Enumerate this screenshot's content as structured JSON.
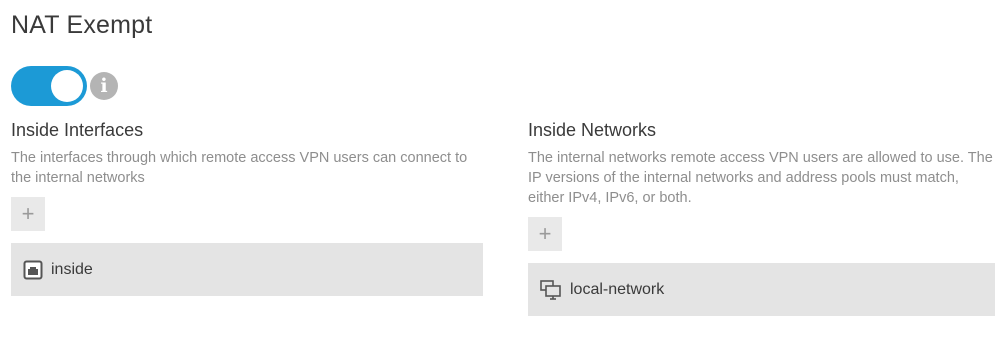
{
  "section": {
    "title": "NAT Exempt",
    "toggle": {
      "state": "on",
      "accent_color": "#1c9ad6"
    },
    "info_glyph": "i"
  },
  "inside_interfaces": {
    "heading": "Inside Interfaces",
    "description": "The interfaces through which remote access VPN users can connect to the internal networks",
    "add_label": "+",
    "items": [
      {
        "label": "inside",
        "icon": "interface-icon"
      }
    ]
  },
  "inside_networks": {
    "heading": "Inside Networks",
    "description": "The internal networks remote access VPN users are allowed to use. The IP versions of the internal networks and address pools must match, either IPv4, IPv6, or both.",
    "add_label": "+",
    "items": [
      {
        "label": "local-network",
        "icon": "network-object-icon"
      }
    ]
  }
}
